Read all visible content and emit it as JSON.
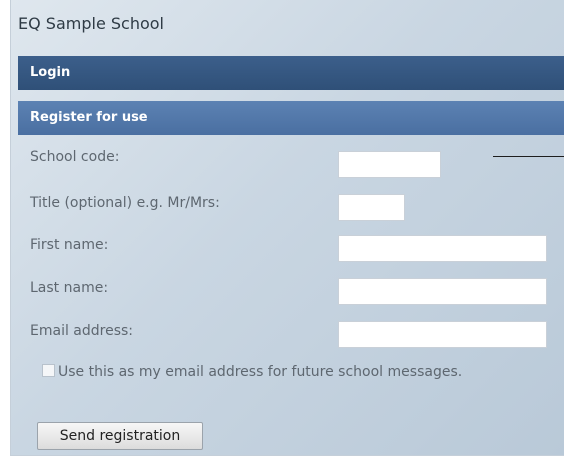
{
  "header": {
    "school_name": "EQ Sample School"
  },
  "login_bar": {
    "label": "Login"
  },
  "register_bar": {
    "label": "Register for use"
  },
  "form": {
    "school_code_label": "School code:",
    "school_code_value": "",
    "title_label": "Title (optional) e.g. Mr/Mrs:",
    "title_value": "",
    "first_name_label": "First name:",
    "first_name_value": "",
    "last_name_label": "Last name:",
    "last_name_value": "",
    "email_label": "Email address:",
    "email_value": "",
    "use_email_checkbox_label": "Use this as my email address for future school messages.",
    "use_email_checked": false,
    "send_button_label": "Send registration"
  }
}
